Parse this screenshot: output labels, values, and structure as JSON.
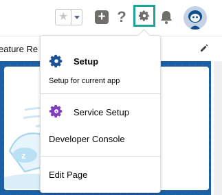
{
  "header": {
    "favorites_star": "★",
    "add_label": "+",
    "help_label": "?"
  },
  "page": {
    "title": "eature Re"
  },
  "setup_menu": {
    "setup_title": "Setup",
    "setup_subtitle": "Setup for current app",
    "service_setup": "Service Setup",
    "developer_console": "Developer Console",
    "edit_page": "Edit Page"
  },
  "colors": {
    "setup_highlight": "#1aa59a",
    "setup_icon": "#1b5297",
    "service_icon": "#7f3fbf",
    "canvas_blue": "#1b5fa5"
  },
  "icons": [
    "star-icon",
    "chevron-down-icon",
    "plus-icon",
    "help-icon",
    "gear-icon",
    "bell-icon",
    "avatar",
    "pencil-icon"
  ]
}
